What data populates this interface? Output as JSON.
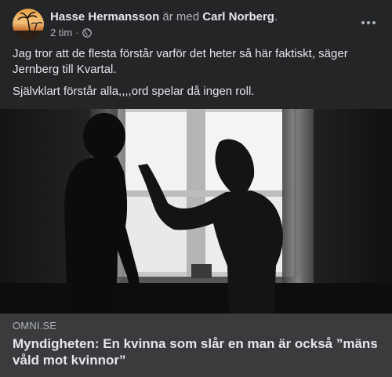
{
  "post": {
    "author": "Hasse Hermansson",
    "with_text": "är med",
    "tagged": "Carl Norberg",
    "period": ".",
    "time": "2 tim",
    "dot": "·",
    "privacy_icon": "globe-icon",
    "paragraphs": [
      "Jag tror att de flesta förstår varför det heter så här faktiskt, säger Jernberg till Kvartal.",
      "Självklart förstår alla,,,,ord spelar då ingen roll."
    ]
  },
  "link": {
    "domain": "OMNI.SE",
    "title": "Myndigheten: En kvinna som slår en man är också ”mäns våld mot kvinnor”"
  },
  "colors": {
    "card_bg": "#242526",
    "link_bg": "#3a3b3c",
    "text_primary": "#e4e6eb",
    "text_secondary": "#b0b3b8"
  }
}
